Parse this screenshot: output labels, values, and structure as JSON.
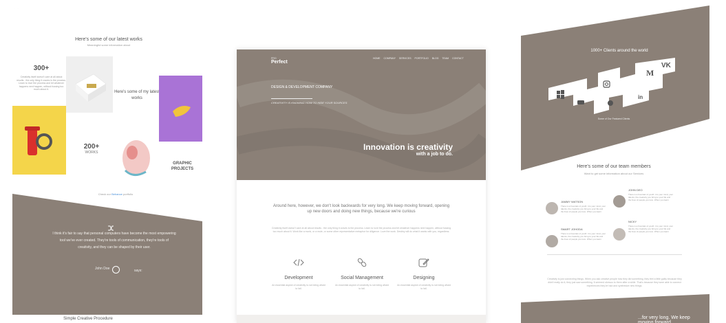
{
  "left_panel": {
    "section_title": "Here's some of our latest works",
    "section_subtitle": "Meaningful some information about",
    "stat_a": {
      "number": "300+",
      "description": "Creativity itself doesn't care at all about results - the only thing it craves is the process. Learn to love the process and let whatever happens next happen, without fussing too much about it."
    },
    "works_text": "Here's some of my latest works",
    "stat_b": {
      "number": "200+",
      "label": "WORKS"
    },
    "graphic_projects": "GRAPHIC PROJECTS",
    "behance_pre": "Check our",
    "behance_link": "Behance",
    "behance_post": "portfolio",
    "quote": "I think it's fair to say that personal computers have become the most empowering tool we've ever created. They're tools of communication, they're tools of creativity, and they can be shaped by their user.",
    "quote_author": "John Doe",
    "quote_says": "says:",
    "bottom_heading": "Simple Creative Procedure"
  },
  "center_panel": {
    "brand_pre": "PRO",
    "brand": "Perfect",
    "nav": [
      "HOME",
      "COMPANY",
      "SERVICES",
      "PORTFOLIO",
      "BLOG",
      "TEAM",
      "CONTACT"
    ],
    "hero_heading": "DESIGN & DEVELOPMENT COMPANY",
    "hero_tagline": "CREATIVITY IS KNOWING HOW TO HIDE YOUR SOURCES",
    "headline": "Innovation is creativity",
    "subheadline": "with a job to do.",
    "lead": "Around here, however, we don't look backwards for very long. We keep moving forward, opening up new doors and doing new things, because we're curious",
    "body": "Creativity itself doesn't care at all about results - the only thing it craves is the process. Learn to love the process and let whatever happens next happen, without fussing too much about it. Work like a monk, or a mule, or some other representative metaphor for diligence. Love the work. Destiny will do what it wants with you, regardless.",
    "services": [
      {
        "icon": "code-icon",
        "title": "Development",
        "description": "An essential aspect of creativity is not being afraid to fail."
      },
      {
        "icon": "link-icon",
        "title": "Social Management",
        "description": "An essential aspect of creativity is not being afraid to fail."
      },
      {
        "icon": "edit-icon",
        "title": "Designing",
        "description": "An essential aspect of creativity is not being afraid to fail."
      }
    ]
  },
  "right_panel": {
    "clients_title": "1000+ Clients around the world",
    "clients_sub": "Some of Our Featured Clients",
    "team_title": "Here's some of our team members",
    "team_sub": "Want to get some information about our Services",
    "members": [
      {
        "name": "JAMMY WATSON",
        "description": "There is a Fountain of youth: it is your mind, your talents, the creativity you bring to your life and the lives of people you love. When you learn"
      },
      {
        "name": "JOHN DEO",
        "description": "There is a Fountain of youth: it is your mind, your talents, the creativity you bring to your life and the lives of people you love. When you learn"
      },
      {
        "name": "SMART JOHODA",
        "description": "There is a Fountain of youth: it is your mind, your talents, the creativity you bring to your life and the lives of people you love. When you learn"
      },
      {
        "name": "NICKY",
        "description": "There is a Fountain of youth: it is your mind, your talents, the creativity you bring to your life and the lives of people you love. When you learn"
      }
    ],
    "footnote": "Creativity is just connecting things. When you ask creative people how they did something, they feel a little guilty because they didn't really do it, they just saw something. It seemed obvious to them after a while. That's because they were able to connect experiences they've had and synthesize new things.",
    "bottom_text": "...for very long. We keep moving forward,"
  },
  "colors": {
    "taupe": "#8b8077",
    "accent_blue": "#4a90d9"
  }
}
